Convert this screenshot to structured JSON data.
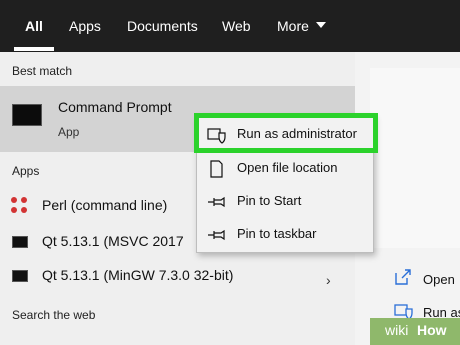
{
  "tabs": {
    "all": "All",
    "apps": "Apps",
    "documents": "Documents",
    "web": "Web",
    "more": "More"
  },
  "sections": {
    "best_match": "Best match",
    "apps": "Apps",
    "search_web": "Search the web"
  },
  "best_match": {
    "title": "Command Prompt",
    "subtitle": "App"
  },
  "app_results": [
    {
      "label": "Perl (command line)",
      "icon": "perl-icon"
    },
    {
      "label": "Qt 5.13.1 (MSVC 2017",
      "icon": "console-icon"
    },
    {
      "label": "Qt 5.13.1 (MinGW 7.3.0 32-bit)",
      "icon": "console-icon"
    }
  ],
  "context_menu": [
    {
      "label": "Run as administrator",
      "icon": "admin-shield-icon"
    },
    {
      "label": "Open file location",
      "icon": "file-icon"
    },
    {
      "label": "Pin to Start",
      "icon": "pin-icon"
    },
    {
      "label": "Pin to taskbar",
      "icon": "pin-icon"
    }
  ],
  "right_actions": [
    {
      "label": "Open",
      "icon": "open-icon"
    },
    {
      "label": "Run as",
      "icon": "admin-shield-icon"
    }
  ],
  "watermark": {
    "prefix": "wiki",
    "suffix": "How"
  },
  "colors": {
    "highlight": "#2bd22b",
    "topbar": "#1f1f1f",
    "selected_row": "#d3d3d3",
    "icon_blue": "#2a6fd8"
  }
}
